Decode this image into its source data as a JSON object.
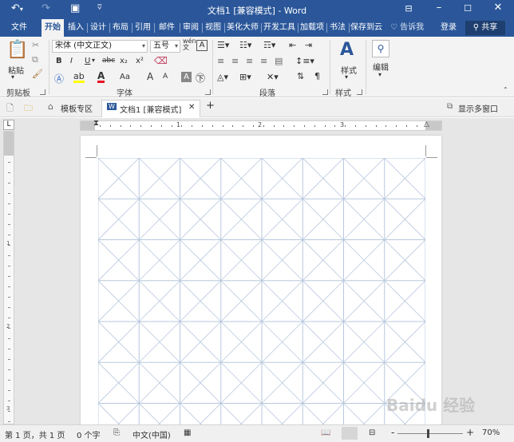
{
  "titlebar": {
    "title": "文档1 [兼容模式] - Word",
    "undo_icon": "undo-icon",
    "redo_icon": "redo-icon",
    "save_icon": "save-icon",
    "customize_icon": "customize-quick-access-icon",
    "ribbon_display_icon": "ribbon-display-options-icon",
    "minimize_icon": "minimize-icon",
    "maximize_icon": "maximize-icon",
    "close_icon": "close-icon"
  },
  "tabs": {
    "items": [
      "文件",
      "开始",
      "插入",
      "设计",
      "布局",
      "引用",
      "邮件",
      "审阅",
      "视图",
      "美化大师",
      "开发工具",
      "加载项",
      "书法",
      "保存到云"
    ],
    "active": "开始",
    "tell_me": "告诉我",
    "login": "登录",
    "share": "共享"
  },
  "ribbon": {
    "clipboard": {
      "label": "剪贴板",
      "paste": "粘贴"
    },
    "font": {
      "label": "字体",
      "font_name": "宋体 (中文正文)",
      "font_size": "五号",
      "bold": "B",
      "italic": "I",
      "underline": "U",
      "strike": "abc",
      "subscript": "x₂",
      "superscript": "x²",
      "change_case": "Aa",
      "grow": "A",
      "shrink": "A",
      "pinyin": "wén",
      "border_char": "A"
    },
    "paragraph": {
      "label": "段落"
    },
    "styles": {
      "label": "样式",
      "button": "样式"
    },
    "editing": {
      "button": "编辑"
    }
  },
  "doctabs": {
    "template": "模板专区",
    "document": "文档1 [兼容模式]",
    "show_multi": "显示多窗口"
  },
  "ruler": {
    "h_numbers": [
      "1",
      "2",
      "3"
    ],
    "v_numbers": [
      "1",
      "2",
      "3"
    ]
  },
  "status": {
    "page": "第 1 页，共 1 页",
    "words": "0 个字",
    "language": "中文(中国)",
    "zoom": "70%",
    "zoom_minus": "-",
    "zoom_plus": "+"
  },
  "grid": {
    "cols": 8,
    "rows": 6,
    "line_color": "#b8c8de"
  },
  "colors": {
    "accent": "#2b579a",
    "font_color_red": "#e81123",
    "highlight_yellow": "#ffff00"
  },
  "watermark": "Baidu 经验"
}
